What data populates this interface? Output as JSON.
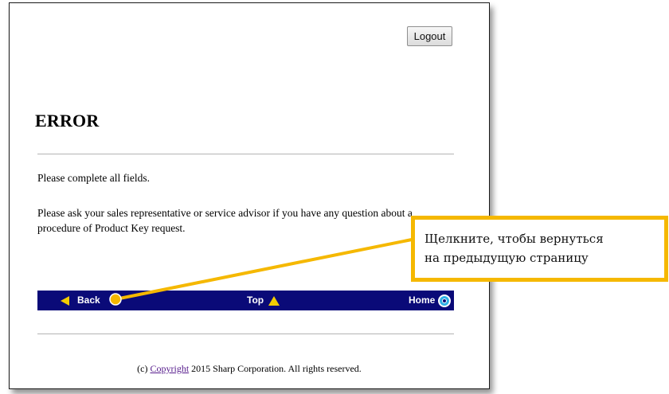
{
  "header": {
    "logout_label": "Logout"
  },
  "main": {
    "title": "ERROR",
    "message_1": "Please complete all fields.",
    "message_2": "Please ask your sales representative or service advisor if you have any question about a procedure of Product Key request."
  },
  "nav_bar": {
    "back_label": "Back",
    "top_label": "Top",
    "home_label": "Home",
    "icons": {
      "back": "arrow-left-icon",
      "top": "arrow-up-icon",
      "home": "home-circle-icon"
    },
    "colors": {
      "background": "#0a0a78",
      "arrow": "#f2cc00"
    }
  },
  "footer": {
    "prefix": "(c)",
    "link_label": "Copyright",
    "suffix": "2015 Sharp Corporation. All rights reserved."
  },
  "callout": {
    "line_1": "Щелкните, чтобы вернуться",
    "line_2": "на предыдущую страницу",
    "color": "#f5b800"
  }
}
